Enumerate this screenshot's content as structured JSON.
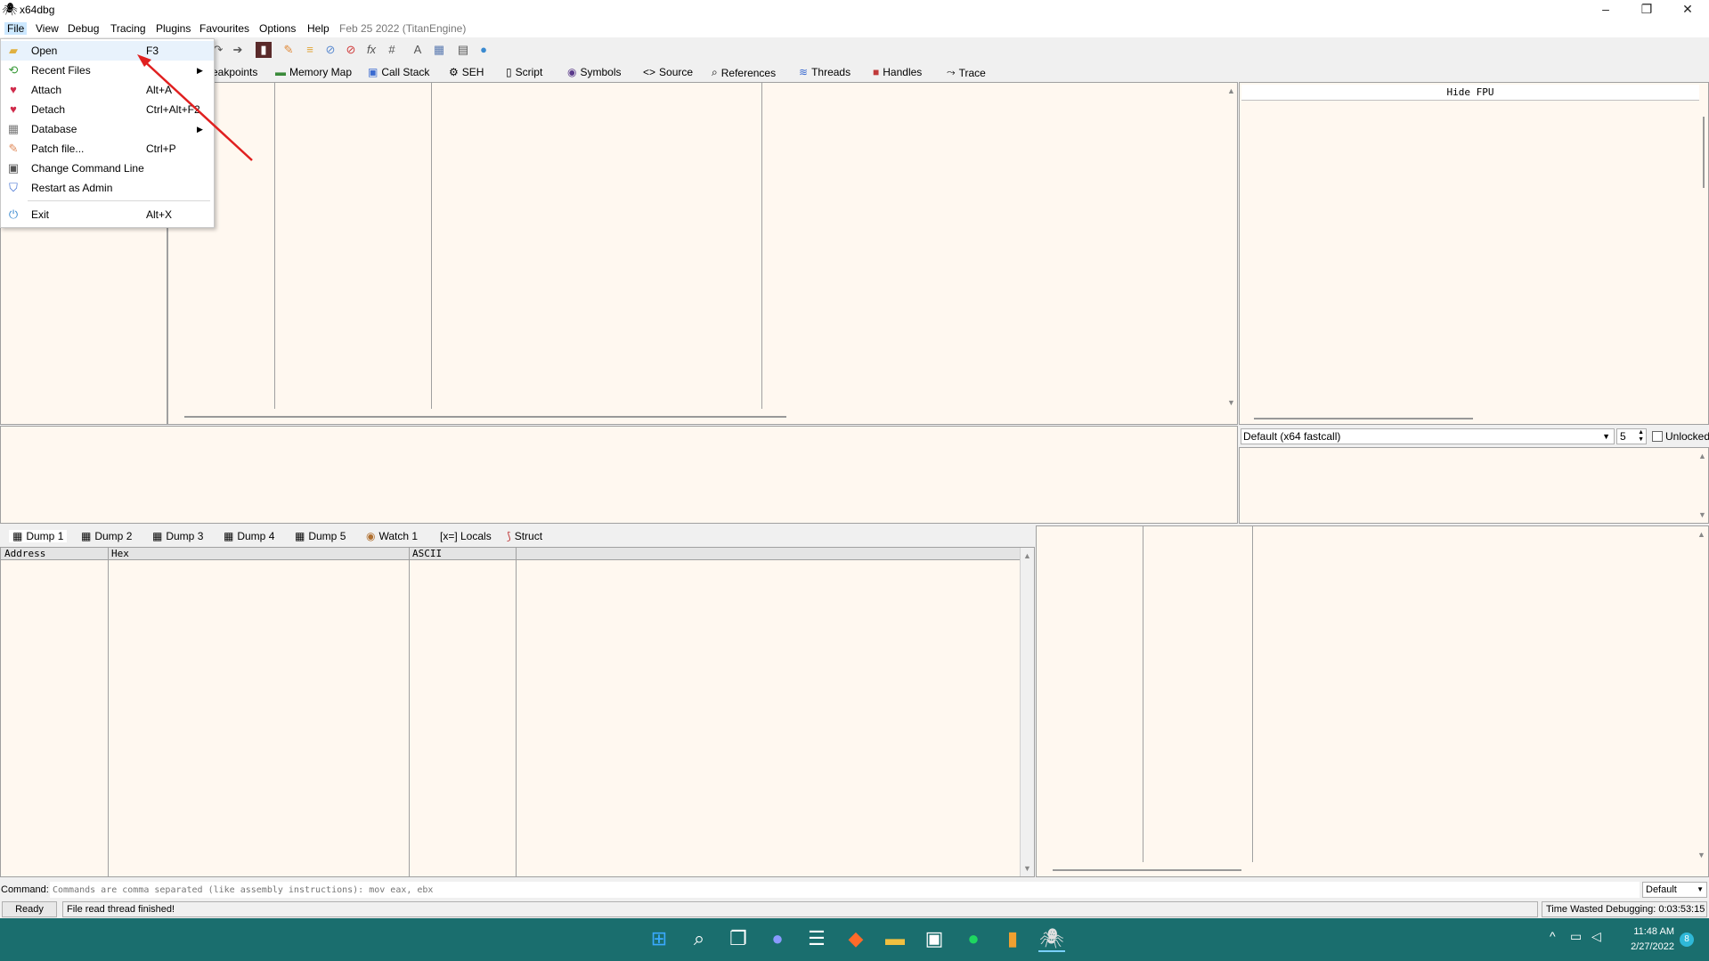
{
  "window": {
    "title": "x64dbg",
    "controls": {
      "minimize": "–",
      "restore": "❐",
      "close": "✕"
    }
  },
  "menubar": {
    "items": [
      "File",
      "View",
      "Debug",
      "Tracing",
      "Plugins",
      "Favourites",
      "Options",
      "Help"
    ],
    "build_info": "Feb 25 2022 (TitanEngine)"
  },
  "cpu_tabs": [
    "eakpoints",
    "Memory Map",
    "Call Stack",
    "SEH",
    "Script",
    "Symbols",
    "Source",
    "References",
    "Threads",
    "Handles",
    "Trace"
  ],
  "file_menu": {
    "items": [
      {
        "label": "Open",
        "shortcut": "F3",
        "icon": "folder-open-icon"
      },
      {
        "label": "Recent Files",
        "shortcut": "",
        "icon": "recent-files-icon",
        "submenu": true
      },
      {
        "label": "Attach",
        "shortcut": "Alt+A",
        "icon": "attach-icon"
      },
      {
        "label": "Detach",
        "shortcut": "Ctrl+Alt+F2",
        "icon": "detach-icon"
      },
      {
        "label": "Database",
        "shortcut": "",
        "icon": "database-icon",
        "submenu": true
      },
      {
        "label": "Patch file...",
        "shortcut": "Ctrl+P",
        "icon": "patch-icon"
      },
      {
        "label": "Change Command Line",
        "shortcut": "",
        "icon": "command-line-icon"
      },
      {
        "label": "Restart as Admin",
        "shortcut": "",
        "icon": "shield-icon"
      },
      {
        "label": "Exit",
        "shortcut": "Alt+X",
        "icon": "power-icon"
      }
    ]
  },
  "fpu": {
    "hide_label": "Hide FPU"
  },
  "call_conv": {
    "selected": "Default (x64 fastcall)",
    "arg_count": "5",
    "unlocked_label": "Unlocked"
  },
  "dump_tabs": [
    "Dump 1",
    "Dump 2",
    "Dump 3",
    "Dump 4",
    "Dump 5",
    "Watch 1",
    "[x=] Locals",
    "Struct"
  ],
  "dump_columns": [
    "Address",
    "Hex",
    "ASCII"
  ],
  "command": {
    "label": "Command:",
    "placeholder": "Commands are comma separated (like assembly instructions): mov eax, ebx",
    "mode": "Default"
  },
  "status": {
    "state": "Ready",
    "message": "File read thread finished!",
    "time_wasted": "Time Wasted Debugging: 0:03:53:15"
  },
  "taskbar": {
    "time": "11:48 AM",
    "date": "2/27/2022",
    "notifications": "8"
  },
  "colors": {
    "panel_bg": "#fff8f0",
    "taskbar_bg": "#1a6e6e",
    "menu_highlight": "#cce8ff",
    "annotation_arrow": "#e02020"
  }
}
